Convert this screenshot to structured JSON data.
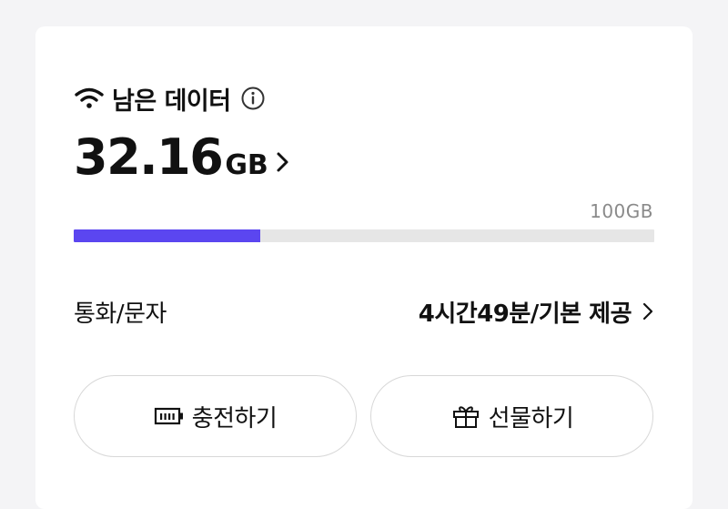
{
  "data_card": {
    "title": "남은 데이터",
    "remaining_value": "32.16",
    "remaining_unit": "GB",
    "total_label": "100GB",
    "usage_fraction": 0.3216
  },
  "call_row": {
    "label": "통화/문자",
    "value": "4시간49분/기본 제공"
  },
  "buttons": {
    "charge": "충전하기",
    "gift": "선물하기"
  },
  "colors": {
    "accent": "#5b46f0",
    "track": "#e6e6e6",
    "background": "#f4f4f6",
    "card": "#ffffff"
  },
  "icons": {
    "header": "wifi-icon",
    "info": "info-icon",
    "charge": "battery-icon",
    "gift": "gift-icon"
  }
}
